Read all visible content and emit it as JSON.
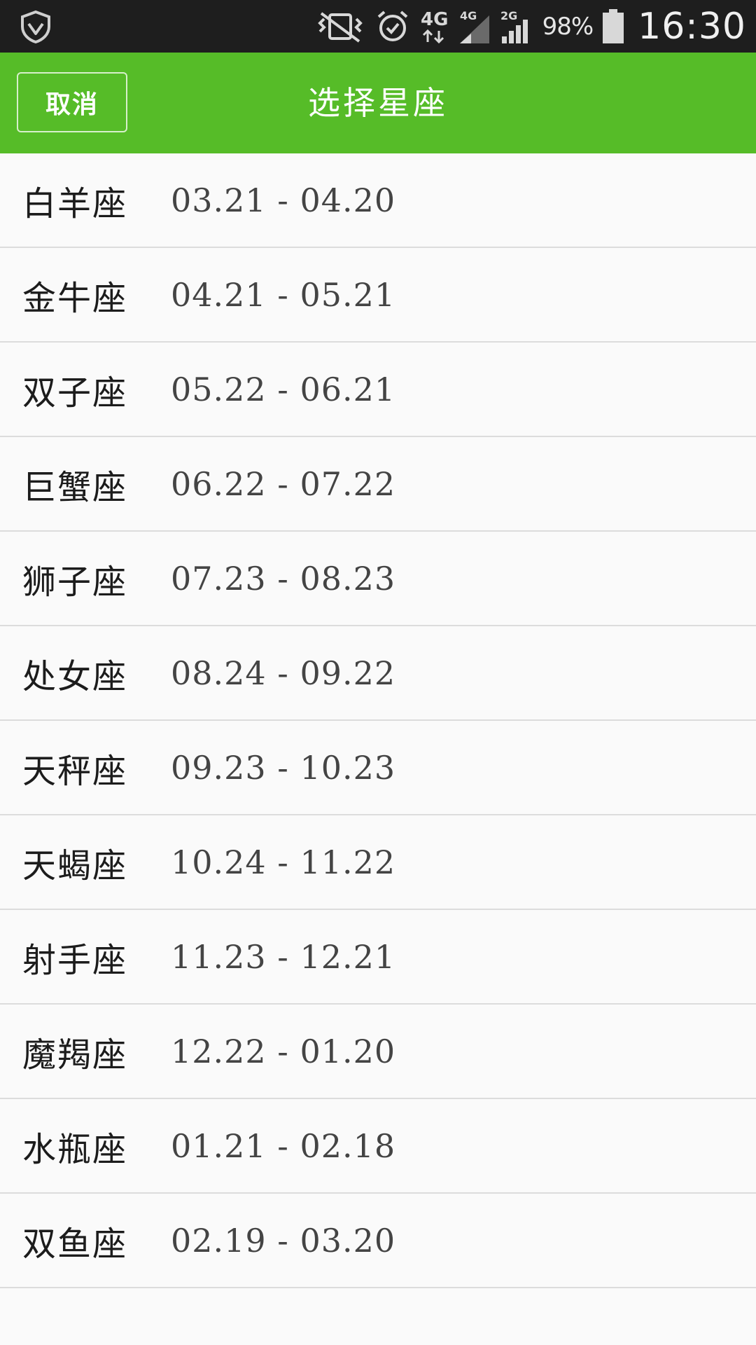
{
  "status_bar": {
    "battery_percent": "98%",
    "time": "16:30",
    "icons": [
      "shield-icon",
      "vibrate-mute-icon",
      "alarm-icon",
      "4g-data-icon",
      "signal-4g-icon",
      "signal-2g-icon",
      "battery-icon"
    ],
    "network_label_1": "4G",
    "network_label_2": "4G",
    "network_label_3": "2G"
  },
  "header": {
    "cancel_label": "取消",
    "title": "选择星座",
    "background_color": "#56bc28"
  },
  "zodiac_list": [
    {
      "name": "白羊座",
      "dates": "03.21 - 04.20"
    },
    {
      "name": "金牛座",
      "dates": "04.21 - 05.21"
    },
    {
      "name": "双子座",
      "dates": "05.22 - 06.21"
    },
    {
      "name": "巨蟹座",
      "dates": "06.22 - 07.22"
    },
    {
      "name": "狮子座",
      "dates": "07.23 - 08.23"
    },
    {
      "name": "处女座",
      "dates": "08.24 - 09.22"
    },
    {
      "name": "天秤座",
      "dates": "09.23 - 10.23"
    },
    {
      "name": "天蝎座",
      "dates": "10.24 - 11.22"
    },
    {
      "name": "射手座",
      "dates": "11.23 - 12.21"
    },
    {
      "name": "魔羯座",
      "dates": "12.22 - 01.20"
    },
    {
      "name": "水瓶座",
      "dates": "01.21 - 02.18"
    },
    {
      "name": "双鱼座",
      "dates": "02.19 - 03.20"
    }
  ]
}
